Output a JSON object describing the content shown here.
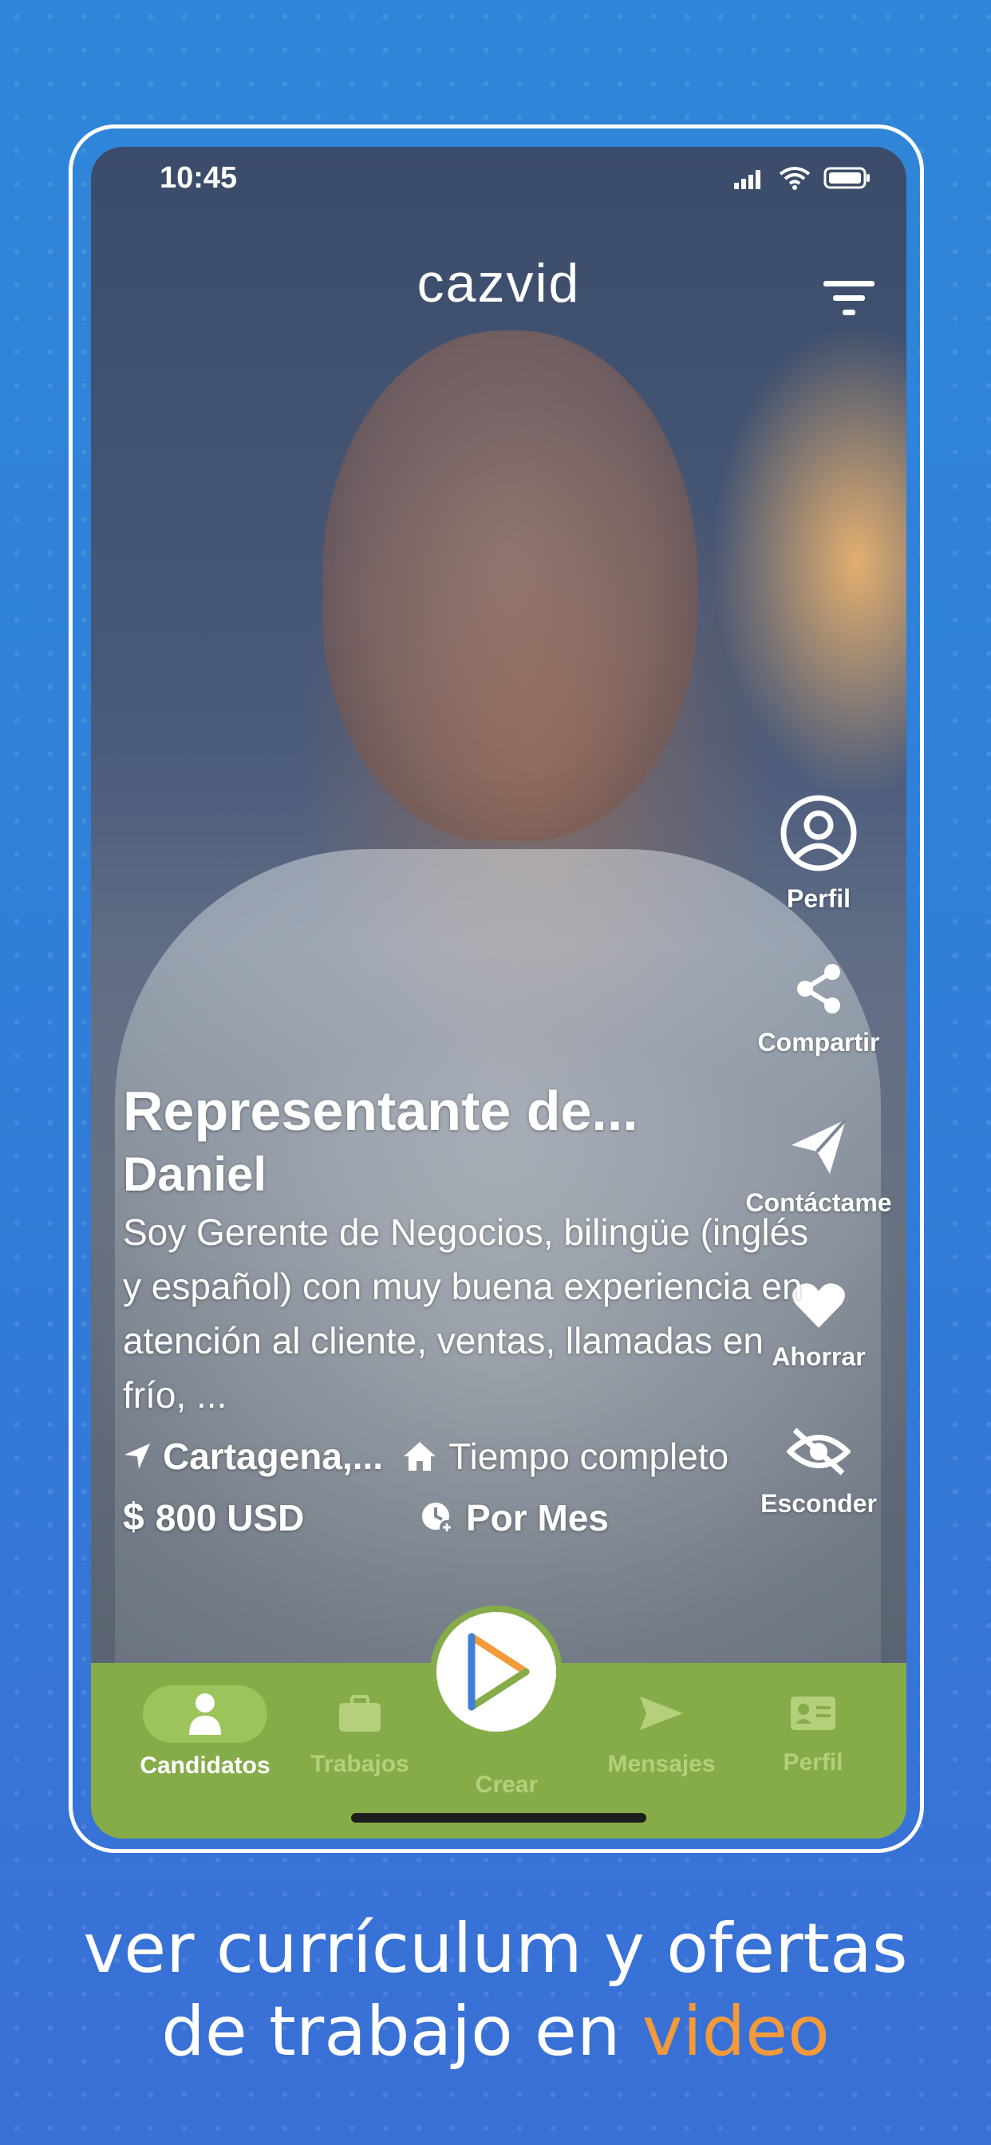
{
  "status_bar": {
    "time": "10:45",
    "icons": [
      "signal-icon",
      "wifi-icon",
      "battery-icon"
    ]
  },
  "app": {
    "logo": "cazvid",
    "filter_icon": "filter-icon"
  },
  "side_actions": [
    {
      "icon": "profile-icon",
      "label": "Perfil"
    },
    {
      "icon": "share-icon",
      "label": "Compartir"
    },
    {
      "icon": "send-icon",
      "label": "Contáctame"
    },
    {
      "icon": "heart-icon",
      "label": "Ahorrar"
    },
    {
      "icon": "eye-off-icon",
      "label": "Esconder"
    }
  ],
  "candidate": {
    "title": "Representante de...",
    "name": "Daniel",
    "description": "Soy Gerente de Negocios, bilingüe (inglés y español) con muy buena experiencia en atención al cliente, ventas, llamadas en frío, ...",
    "location": "Cartagena,...",
    "job_type": "Tiempo completo",
    "salary": "800 USD",
    "period": "Por Mes"
  },
  "bottom_nav": {
    "items": [
      {
        "icon": "person-icon",
        "label": "Candidatos",
        "active": true
      },
      {
        "icon": "briefcase-icon",
        "label": "Trabajos",
        "active": false
      },
      {
        "icon": "play-icon",
        "label": "Crear",
        "active": false
      },
      {
        "icon": "send-icon",
        "label": "Mensajes",
        "active": false
      },
      {
        "icon": "id-card-icon",
        "label": "Perfil",
        "active": false
      }
    ]
  },
  "caption": {
    "line1": "ver currículum y ofertas",
    "line2_prefix": "de trabajo en ",
    "line2_accent": "video"
  },
  "colors": {
    "nav_green": "#86ac49",
    "accent_orange": "#f39a3a",
    "background_blue": "#2f80d8"
  }
}
